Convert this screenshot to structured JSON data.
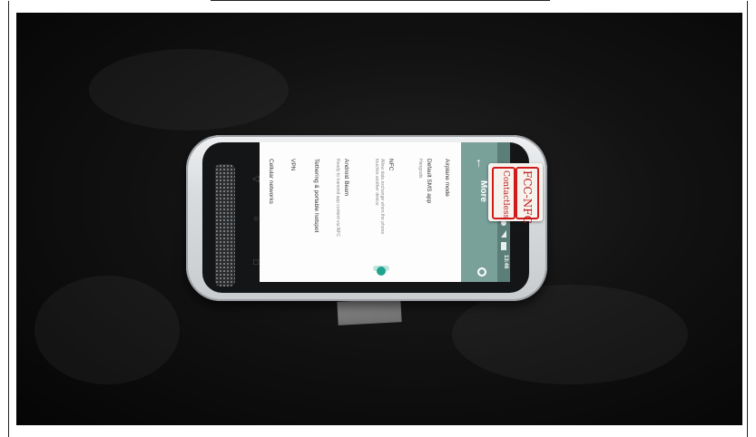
{
  "device_screen": {
    "status_bar": {
      "time": "13:46"
    },
    "app_bar": {
      "back_icon": "arrow-left",
      "title": "More",
      "search_icon": "magnifier"
    },
    "items": [
      {
        "title": "Airplane mode",
        "subtitle": ""
      },
      {
        "title": "Default SMS app",
        "subtitle": "Hangouts"
      },
      {
        "title": "NFC",
        "subtitle": "Allow data exchange when the phone touches another device"
      },
      {
        "title": "Android Beam",
        "subtitle": "Ready to transmit app content via NFC"
      },
      {
        "title": "Tethering & portable hotspot",
        "subtitle": ""
      },
      {
        "title": "VPN",
        "subtitle": ""
      },
      {
        "title": "Cellular networks",
        "subtitle": ""
      }
    ],
    "nfc_toggle": {
      "state": "on",
      "color": "#1fa58e"
    },
    "accent_color": "#7aa09a"
  },
  "label_sticker": {
    "line1": "FCC-NFC",
    "line2": "Contactless",
    "color": "#c21818"
  }
}
